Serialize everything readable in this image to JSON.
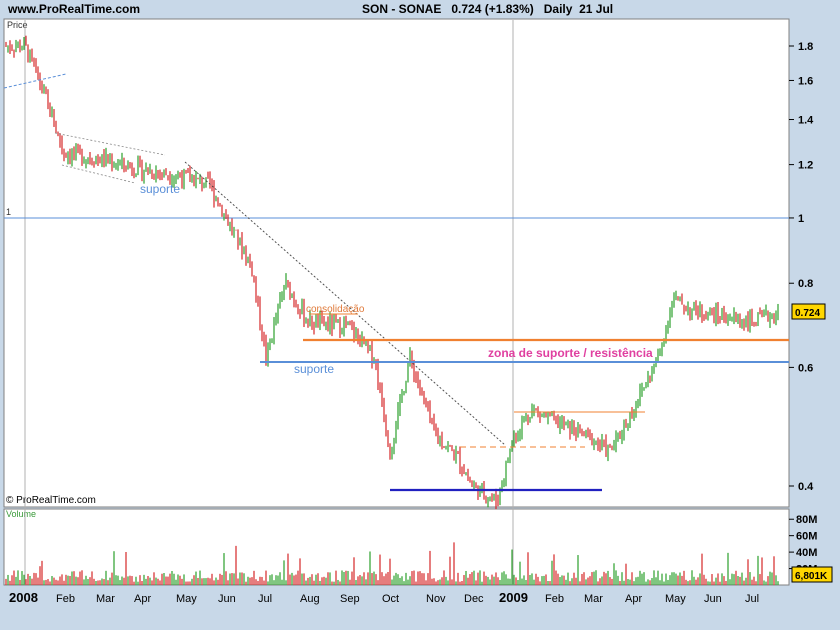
{
  "header": {
    "site": "www.ProRealTime.com",
    "title": "SON - SONAE   0.724 (+1.83%)   Daily  21 Jul"
  },
  "price_panel": {
    "label": "Price",
    "ref_label": "1",
    "copyright": "© ProRealTime.com",
    "last_price_badge": "0.724"
  },
  "volume_panel": {
    "label": "Volume",
    "last_volume_badge": "6,801K",
    "ticks": [
      "80M",
      "60M",
      "40M",
      "20M"
    ]
  },
  "annotations": {
    "suporte_top": "suporte",
    "suporte_mid": "suporte",
    "consolidacao": "consolidação",
    "zona": "zona de suporte / resistência"
  },
  "colors": {
    "up": "#2ca02c",
    "down": "#d62728",
    "support_blue": "#5a8fd8",
    "resistance_orange": "#f08030",
    "bottom_line": "#2020c0"
  },
  "chart_data": [
    {
      "type": "line",
      "title": "SON - SONAE",
      "xlabel": "",
      "ylabel": "Price",
      "scale": "log",
      "ylim": [
        0.37,
        1.95
      ],
      "y_ticks": [
        1.8,
        1.6,
        1.4,
        1.2,
        1,
        0.8,
        0.6,
        0.4
      ],
      "x_labels": [
        "2008",
        "Feb",
        "Mar",
        "Apr",
        "May",
        "Jun",
        "Jul",
        "Aug",
        "Sep",
        "Oct",
        "Nov",
        "Dec",
        "2009",
        "Feb",
        "Mar",
        "Apr",
        "May",
        "Jun",
        "Jul"
      ],
      "series": [
        {
          "x": [
            "2008-01",
            "2008-01-15",
            "2008-02",
            "2008-03",
            "2008-04",
            "2008-05",
            "2008-05-20",
            "2008-06",
            "2008-06-20",
            "2008-07",
            "2008-07-15",
            "2008-08",
            "2008-09",
            "2008-09-20",
            "2008-10",
            "2008-10-15",
            "2008-11",
            "2008-11-20",
            "2008-12",
            "2008-12-20",
            "2009-01",
            "2009-01-15",
            "2009-02",
            "2009-03",
            "2009-03-15",
            "2009-04",
            "2009-04-20",
            "2009-05",
            "2009-05-15",
            "2009-06",
            "2009-07",
            "2009-07-21"
          ],
          "values": [
            1.8,
            1.55,
            1.25,
            1.22,
            1.18,
            1.15,
            1.12,
            1.0,
            0.85,
            0.62,
            0.8,
            0.7,
            0.69,
            0.62,
            0.45,
            0.62,
            0.48,
            0.44,
            0.4,
            0.38,
            0.47,
            0.52,
            0.5,
            0.47,
            0.45,
            0.52,
            0.62,
            0.76,
            0.73,
            0.72,
            0.7,
            0.724
          ]
        }
      ]
    },
    {
      "type": "bar",
      "title": "Volume",
      "ylim": [
        0,
        90
      ],
      "y_ticks": [
        80,
        60,
        40,
        20
      ],
      "unit": "M"
    }
  ]
}
